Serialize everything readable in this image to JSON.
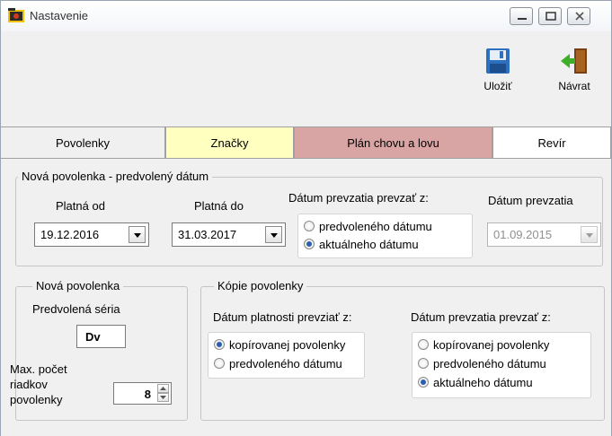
{
  "window": {
    "title": "Nastavenie"
  },
  "toolbar": {
    "save_label": "Uložiť",
    "back_label": "Návrat"
  },
  "tabs": [
    {
      "label": "Povolenky",
      "color": "#f0f0f0",
      "active": true
    },
    {
      "label": "Značky",
      "color": "#ffffc0"
    },
    {
      "label": "Plán chovu a lovu",
      "color": "#d8a4a4"
    },
    {
      "label": "Revír",
      "color": "#ffffff"
    }
  ],
  "group_new_permit_date": {
    "legend": "Nová povolenka - predvolený dátum",
    "valid_from_label": "Platná od",
    "valid_from_value": "19.12.2016",
    "valid_to_label": "Platná do",
    "valid_to_value": "31.03.2017",
    "takeover_source_label": "Dátum prevzatia prevzať z:",
    "option_default": "predvoleného dátumu",
    "option_current": "aktuálneho dátumu",
    "takeover_date_label": "Dátum prevzatia",
    "takeover_date_value": "01.09.2015"
  },
  "group_new_permit": {
    "legend": "Nová povolenka",
    "series_label": "Predvolená séria",
    "series_value": "Dv",
    "max_rows_label_1": "Max. počet",
    "max_rows_label_2": "riadkov",
    "max_rows_label_3": "povolenky",
    "max_rows_value": "8"
  },
  "group_copies": {
    "legend": "Kópie povolenky",
    "validity_label": "Dátum platnosti prevziať z:",
    "validity_option_copied": "kopírovanej povolenky",
    "validity_option_default": "predvoleného dátumu",
    "takeover_label": "Dátum prevzatia  prevzať z:",
    "takeover_option_copied": "kopírovanej povolenky",
    "takeover_option_default": "predvoleného dátumu",
    "takeover_option_current": "aktuálneho dátumu"
  }
}
